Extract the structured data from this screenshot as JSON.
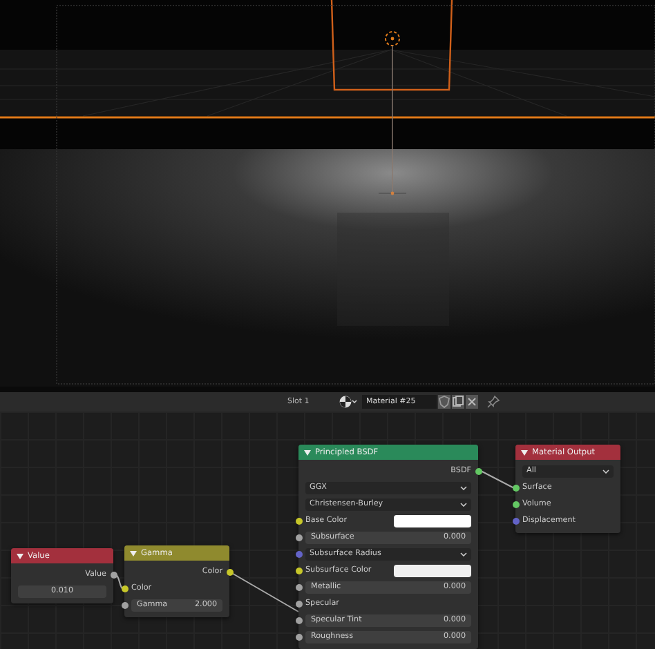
{
  "header": {
    "slot": "Slot 1",
    "material": "Material #25"
  },
  "nodes": [
    {
      "title": "Value",
      "color": "#a3303d",
      "rows": [
        {
          "kind": "output",
          "label": "Value",
          "color": "#a1a1a1"
        },
        {
          "kind": "slider",
          "value": "0.010"
        }
      ]
    },
    {
      "title": "Gamma",
      "color": "#8f8a2e",
      "rows": [
        {
          "kind": "output",
          "label": "Color",
          "color": "#c7c729"
        },
        {
          "kind": "input",
          "label": "Color",
          "color": "#c7c729"
        },
        {
          "kind": "slider",
          "label": "Gamma",
          "value": "2.000",
          "color": "#a1a1a1"
        }
      ]
    },
    {
      "title": "Principled BSDF",
      "color": "#2a8a5a",
      "rows": [
        {
          "kind": "output",
          "label": "BSDF",
          "color": "#63c763"
        },
        {
          "kind": "dropdown",
          "value": "GGX"
        },
        {
          "kind": "dropdown",
          "value": "Christensen-Burley"
        },
        {
          "kind": "swatch",
          "label": "Base Color",
          "color": "#c7c729",
          "swatch": {
            "color": "#ffffff"
          }
        },
        {
          "kind": "slider",
          "label": "Subsurface",
          "value": "0.000",
          "color": "#a1a1a1"
        },
        {
          "kind": "dropdown",
          "value": "Subsurface Radius",
          "color": "#6363c7"
        },
        {
          "kind": "swatch",
          "label": "Subsurface Color",
          "color": "#c7c729",
          "swatch": {
            "color": "#f0f0f0"
          }
        },
        {
          "kind": "slider",
          "label": "Metallic",
          "value": "0.000",
          "color": "#a1a1a1"
        },
        {
          "kind": "input",
          "label": "Specular",
          "color": "#a1a1a1"
        },
        {
          "kind": "slider",
          "label": "Specular Tint",
          "value": "0.000",
          "color": "#a1a1a1"
        },
        {
          "kind": "slider",
          "label": "Roughness",
          "value": "0.000",
          "color": "#a1a1a1"
        }
      ]
    },
    {
      "title": "Material Output",
      "color": "#a3303d",
      "rows": [
        {
          "kind": "dropdown",
          "value": "All"
        },
        {
          "kind": "input",
          "label": "Surface",
          "color": "#63c763"
        },
        {
          "kind": "input",
          "label": "Volume",
          "color": "#63c763"
        },
        {
          "kind": "input",
          "label": "Displacement",
          "color": "#6363c7"
        }
      ]
    }
  ]
}
